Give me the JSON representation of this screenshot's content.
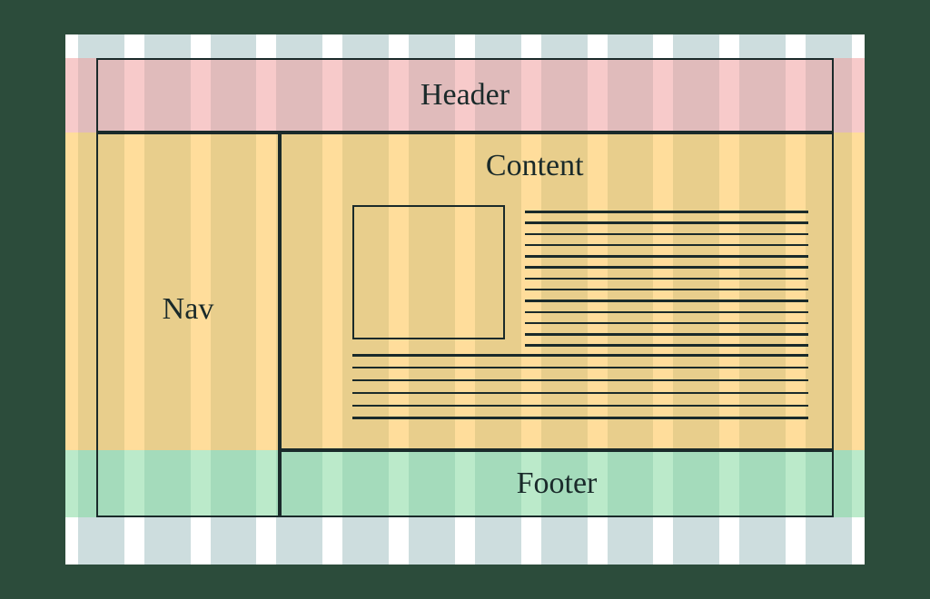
{
  "layout": {
    "header": "Header",
    "nav": "Nav",
    "content": "Content",
    "footer": "Footer"
  },
  "grid": {
    "columns": 12
  },
  "colors": {
    "column_stripe": "#cdddde",
    "header_band": "#f19e9e",
    "body_band": "#ffc148",
    "footer_band": "#83d89e",
    "outline": "#1a2a2a",
    "page_bg": "#2c4c3b"
  }
}
